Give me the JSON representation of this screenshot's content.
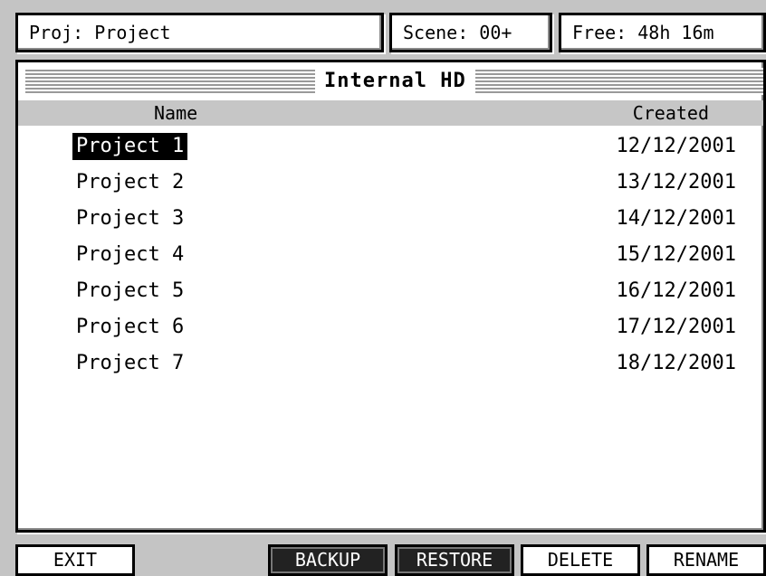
{
  "header": {
    "project": "Proj: Project",
    "scene": "Scene: 00+",
    "free": "Free: 48h 16m"
  },
  "panel": {
    "title": "Internal HD",
    "columns": {
      "name": "Name",
      "created": "Created"
    },
    "rows": [
      {
        "name": "Project 1",
        "created": "12/12/2001",
        "selected": true
      },
      {
        "name": "Project 2",
        "created": "13/12/2001"
      },
      {
        "name": "Project 3",
        "created": "14/12/2001"
      },
      {
        "name": "Project 4",
        "created": "15/12/2001"
      },
      {
        "name": "Project 5",
        "created": "16/12/2001"
      },
      {
        "name": "Project 6",
        "created": "17/12/2001"
      },
      {
        "name": "Project 7",
        "created": "18/12/2001"
      }
    ]
  },
  "buttons": {
    "exit": "EXIT",
    "backup": "BACKUP",
    "restore": "RESTORE",
    "delete": "DELETE",
    "rename": "RENAME"
  }
}
